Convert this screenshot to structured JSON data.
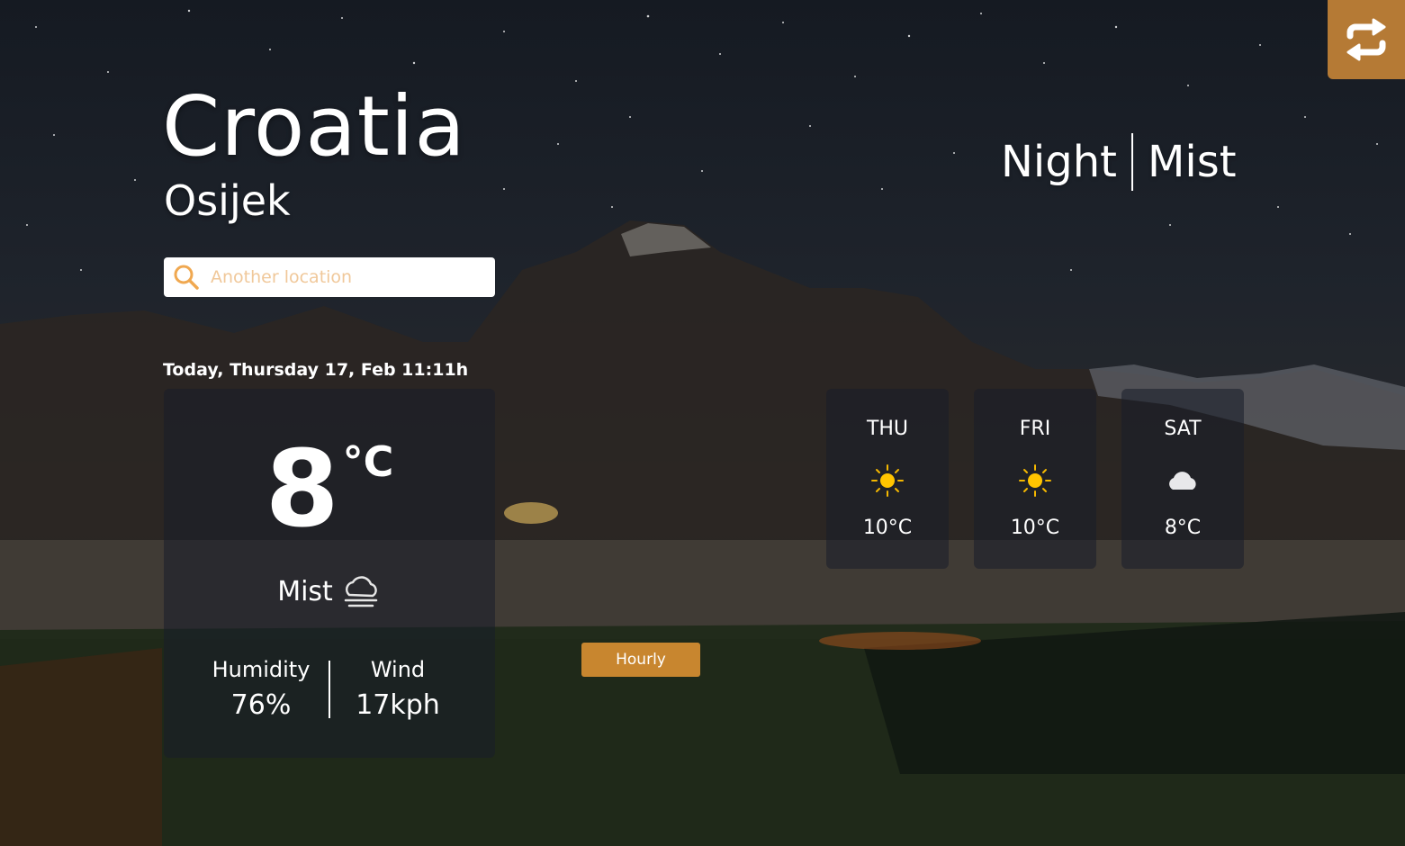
{
  "location": {
    "country": "Croatia",
    "city": "Osijek"
  },
  "search": {
    "placeholder": "Another location"
  },
  "header": {
    "time_of_day": "Night",
    "condition": "Mist"
  },
  "current": {
    "date_text": "Today, Thursday 17, Feb 11:11h",
    "temperature": "8",
    "unit": "°C",
    "condition": "Mist",
    "condition_icon": "mist-cloud-icon",
    "humidity_label": "Humidity",
    "humidity_value": "76%",
    "wind_label": "Wind",
    "wind_value": "17kph"
  },
  "hourly_button": {
    "label": "Hourly"
  },
  "forecast": [
    {
      "day": "THU",
      "icon": "sun-icon",
      "temp": "10°C"
    },
    {
      "day": "FRI",
      "icon": "sun-icon",
      "temp": "10°C"
    },
    {
      "day": "SAT",
      "icon": "cloud-icon",
      "temp": "8°C"
    }
  ],
  "colors": {
    "accent": "#c8862f",
    "swap_button": "#b57a35",
    "card_bg": "#181e2a"
  },
  "swap_button": {
    "icon": "swap-arrows-icon"
  }
}
